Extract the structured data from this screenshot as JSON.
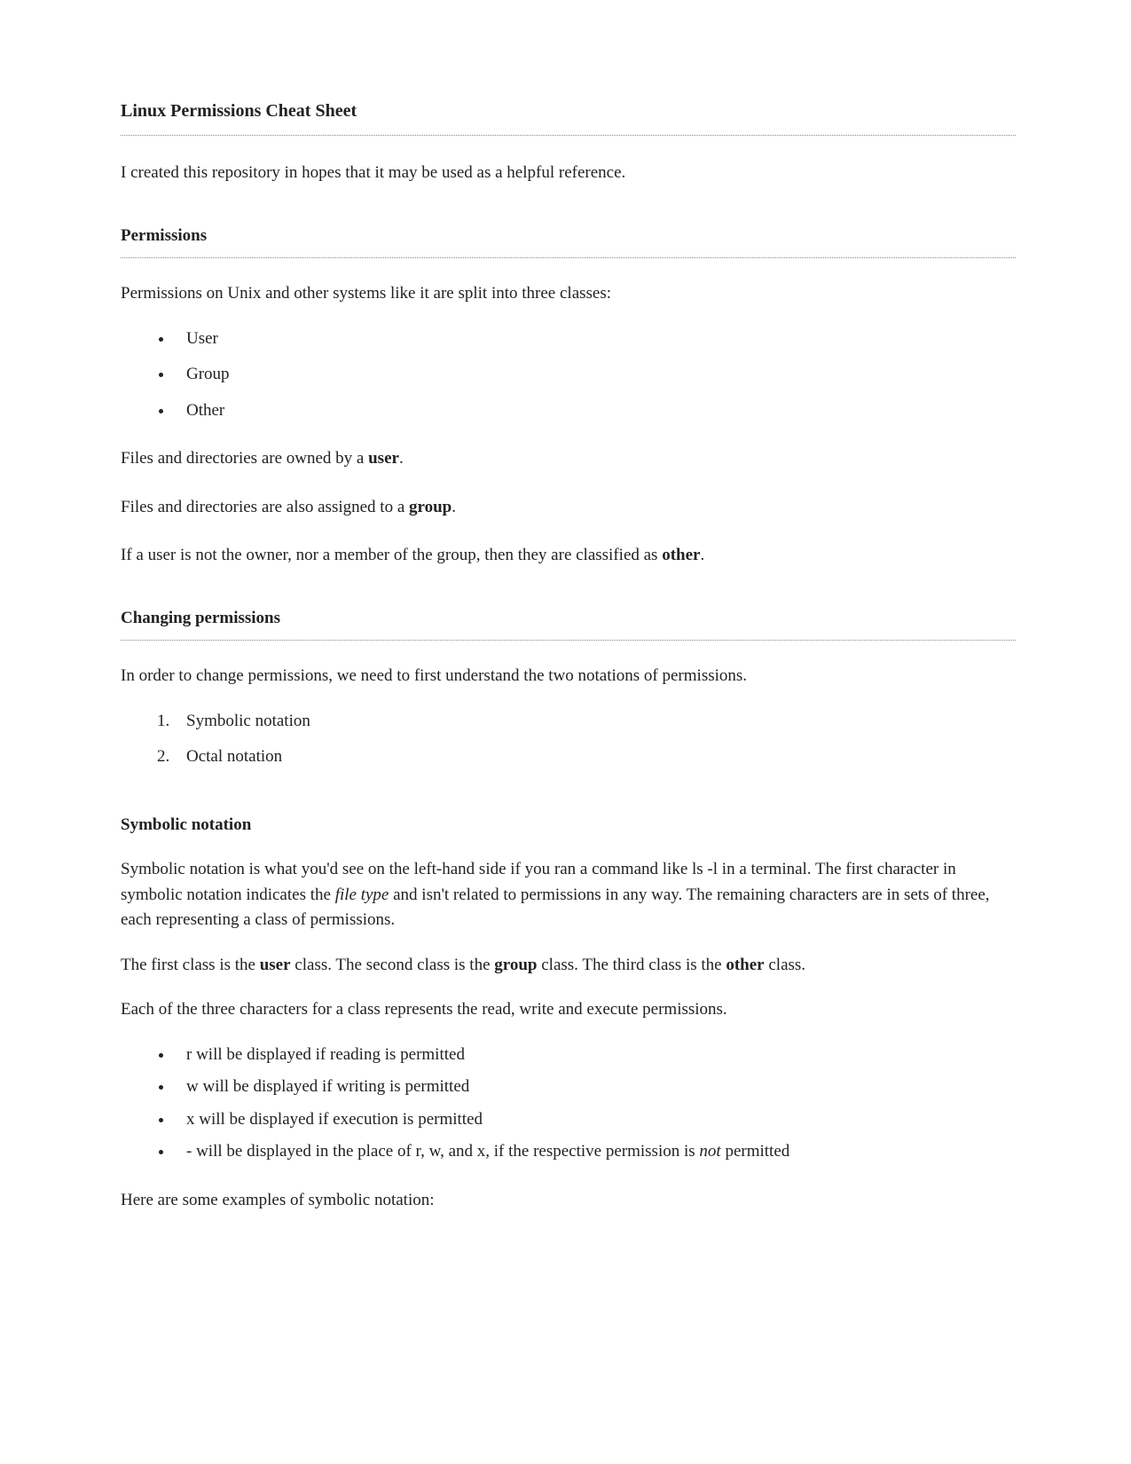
{
  "title": "Linux Permissions Cheat Sheet",
  "intro": "I created this repository in hopes that it may be used as a helpful reference.",
  "permissions": {
    "heading": "Permissions",
    "p1": "Permissions on Unix and other systems like it are split into three classes:",
    "list": [
      "User",
      "Group",
      "Other"
    ],
    "p2a": "Files and directories are owned by a ",
    "p2b": "user",
    "p2c": ".",
    "p3a": "Files and directories are also assigned to a ",
    "p3b": "group",
    "p3c": ".",
    "p4a": "If a user is not the owner, nor a member of the group, then they are classified as ",
    "p4b": "other",
    "p4c": "."
  },
  "changing": {
    "heading": "Changing permissions",
    "p1": "In order to change permissions, we need to first understand the two notations of permissions.",
    "list": [
      "Symbolic notation",
      "Octal notation"
    ]
  },
  "symbolic": {
    "heading": "Symbolic notation",
    "p1a": "Symbolic notation is what you'd see on the left-hand side if you ran a command like ls -l in a terminal. The first character in symbolic notation indicates the ",
    "p1b": "file type",
    "p1c": " and isn't related to permissions in any way. The remaining characters are in sets of three, each representing a class of permissions.",
    "p2a": "The first class is the ",
    "p2b": "user",
    "p2c": " class. The second class is the ",
    "p2d": "group",
    "p2e": " class. The third class is the ",
    "p2f": "other",
    "p2g": " class.",
    "p3": "Each of the three characters for a class represents the read, write and execute permissions.",
    "list": {
      "0": "r will be displayed if reading is permitted",
      "1": "w will be displayed if writing is permitted",
      "2": "x will be displayed if execution is permitted",
      "3a": "- will be displayed in the place of r, w, and x, if the respective permission is ",
      "3b": "not",
      "3c": " permitted"
    },
    "p4": "Here are some examples of symbolic notation:"
  }
}
